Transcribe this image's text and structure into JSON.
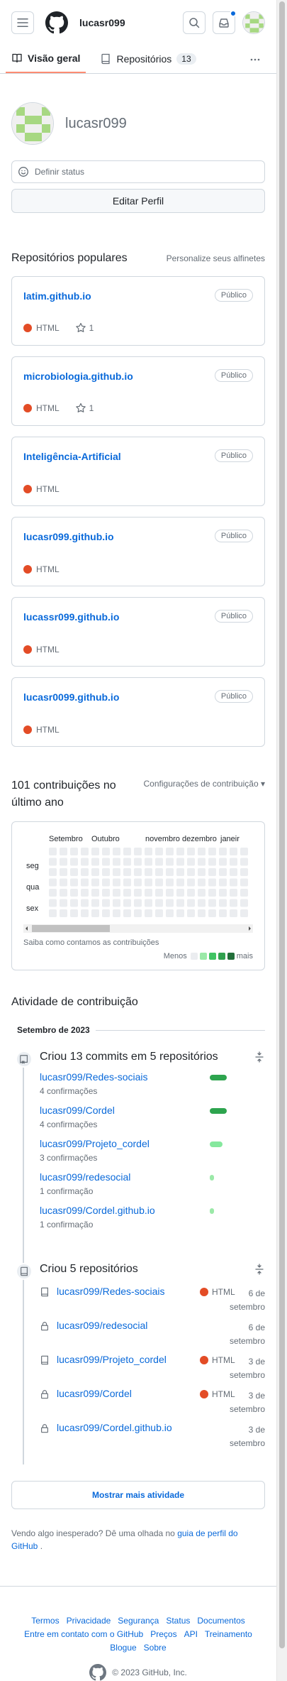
{
  "header": {
    "username": "lucasr099"
  },
  "tabs": {
    "overview": "Visão geral",
    "repositories": "Repositórios",
    "repositories_count": "13"
  },
  "profile": {
    "name": "lucasr099",
    "status_placeholder": "Definir status",
    "edit_label": "Editar Perfil"
  },
  "popular": {
    "title": "Repositórios populares",
    "customize": "Personalize seus alfinetes",
    "repos": [
      {
        "name": "latim.github.io",
        "visibility": "Público",
        "language": "HTML",
        "stars": "1"
      },
      {
        "name": "microbiologia.github.io",
        "visibility": "Público",
        "language": "HTML",
        "stars": "1"
      },
      {
        "name": "Inteligência-Artificial",
        "visibility": "Público",
        "language": "HTML"
      },
      {
        "name": "lucasr099.github.io",
        "visibility": "Público",
        "language": "HTML"
      },
      {
        "name": "lucassr099.github.io",
        "visibility": "Público",
        "language": "HTML"
      },
      {
        "name": "lucasr0099.github.io",
        "visibility": "Público",
        "language": "HTML"
      }
    ]
  },
  "contributions": {
    "title": "101 contribuições no último ano",
    "settings": "Configurações de contribuição",
    "months": [
      "Setembro",
      "Outubro",
      "novembro",
      "dezembro",
      "janeir"
    ],
    "days": [
      "seg",
      "qua",
      "sex"
    ],
    "learn_more": "Saiba como contamos as contribuições",
    "legend_less": "Menos",
    "legend_more": "mais",
    "colors": [
      "#ebedf0",
      "#9be9a8",
      "#40c463",
      "#30a14e",
      "#216e39"
    ]
  },
  "activity": {
    "title": "Atividade de contribuição",
    "month": "Setembro de 2023",
    "commits_title": "Criou 13 commits em 5 repositórios",
    "commits": [
      {
        "repo": "lucasr099/Redes-sociais",
        "count": "4 confirmações",
        "level": 4
      },
      {
        "repo": "lucasr099/Cordel",
        "count": "4 confirmações",
        "level": 4
      },
      {
        "repo": "lucasr099/Projeto_cordel",
        "count": "3 confirmações",
        "level": 3
      },
      {
        "repo": "lucasr099/redesocial",
        "count": "1 confirmação",
        "level": 1
      },
      {
        "repo": "lucasr099/Cordel.github.io",
        "count": "1 confirmação",
        "level": 1
      }
    ],
    "created_title": "Criou 5 repositórios",
    "created": [
      {
        "repo": "lucasr099/Redes-sociais",
        "language": "HTML",
        "date_day": "6 de",
        "date_month": "setembro",
        "private": false
      },
      {
        "repo": "lucasr099/redesocial",
        "language": "",
        "date_day": "6 de",
        "date_month": "setembro",
        "private": true
      },
      {
        "repo": "lucasr099/Projeto_cordel",
        "language": "HTML",
        "date_day": "3 de",
        "date_month": "setembro",
        "private": false
      },
      {
        "repo": "lucasr099/Cordel",
        "language": "HTML",
        "date_day": "3 de",
        "date_month": "setembro",
        "private": true
      },
      {
        "repo": "lucasr099/Cordel.github.io",
        "language": "",
        "date_day": "3 de",
        "date_month": "setembro",
        "private": true
      }
    ],
    "more_label": "Mostrar mais atividade",
    "unexpected_prefix": "Vendo algo inesperado? Dê uma olhada no",
    "unexpected_link": "guia de perfil do GitHub",
    "unexpected_suffix": "."
  },
  "footer": {
    "links": [
      "Termos",
      "Privacidade",
      "Segurança",
      "Status",
      "Documentos",
      "Entre em contato com o GitHub",
      "Preços",
      "API",
      "Treinamento",
      "Blogue",
      "Sobre"
    ],
    "copyright": "© 2023 GitHub, Inc."
  }
}
